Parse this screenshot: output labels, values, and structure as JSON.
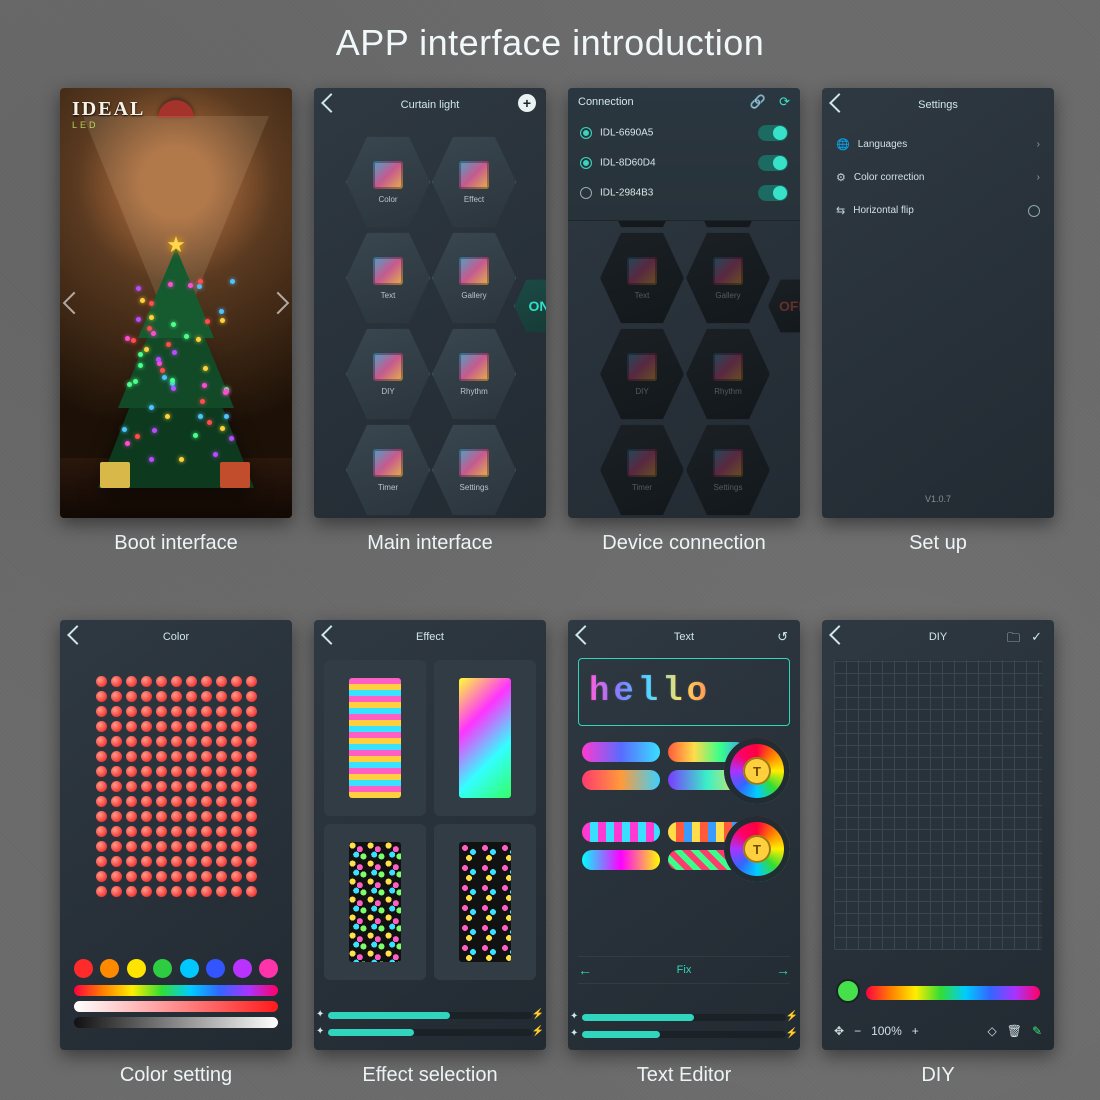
{
  "page_title": "APP interface introduction",
  "screens": {
    "boot": {
      "caption": "Boot interface",
      "brand": "IDEAL",
      "brand_sub": "LED"
    },
    "main": {
      "caption": "Main interface",
      "title": "Curtain light",
      "hex_labels": [
        "Color",
        "Effect",
        "Text",
        "Gallery",
        "DIY",
        "Rhythm",
        "Timer",
        "Settings"
      ],
      "on_label": "ON"
    },
    "device": {
      "caption": "Device connection",
      "title": "Connection",
      "off_label": "OFF",
      "devices": [
        {
          "name": "IDL-6690A5",
          "on": true,
          "selected": true
        },
        {
          "name": "IDL-8D60D4",
          "on": true,
          "selected": true
        },
        {
          "name": "IDL-2984B3",
          "on": true,
          "selected": false
        }
      ]
    },
    "settings": {
      "caption": "Set up",
      "title": "Settings",
      "rows": [
        {
          "icon": "🌐",
          "label": "Languages",
          "action": "chevron"
        },
        {
          "icon": "⚙",
          "label": "Color correction",
          "action": "chevron"
        },
        {
          "icon": "⇆",
          "label": "Horizontal flip",
          "action": "radio"
        }
      ],
      "version": "V1.0.7"
    },
    "color": {
      "caption": "Color setting",
      "title": "Color",
      "swatches": [
        "#ff2a2a",
        "#ff8a00",
        "#ffe400",
        "#2ecc40",
        "#00c8ff",
        "#3355ff",
        "#b833ff",
        "#ff33aa"
      ]
    },
    "effect": {
      "caption": "Effect selection",
      "title": "Effect",
      "slider1_pct": 60,
      "slider2_pct": 42
    },
    "text": {
      "caption": "Text Editor",
      "title": "Text",
      "preview": "hello",
      "fix_label": "Fix",
      "slider1_pct": 55,
      "slider2_pct": 38
    },
    "diy": {
      "caption": "DIY",
      "title": "DIY",
      "zoom": "100%"
    }
  }
}
